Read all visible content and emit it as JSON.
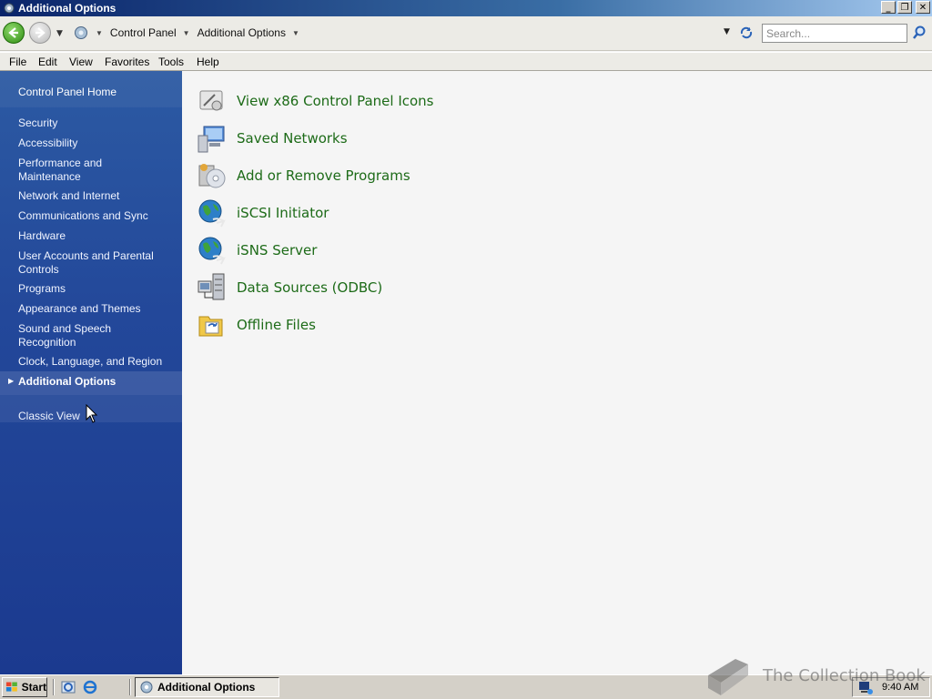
{
  "window": {
    "title": "Additional Options"
  },
  "address": {
    "crumbs": [
      "Control Panel",
      "Additional Options"
    ],
    "search_placeholder": "Search..."
  },
  "menu": [
    "File",
    "Edit",
    "View",
    "Favorites",
    "Tools",
    "Help"
  ],
  "sidebar": {
    "home": "Control Panel Home",
    "categories": [
      "Security",
      "Accessibility",
      "Performance and Maintenance",
      "Network and Internet",
      "Communications and Sync",
      "Hardware",
      "User Accounts and Parental Controls",
      "Programs",
      "Appearance and Themes",
      "Sound and Speech Recognition",
      "Clock, Language, and Region",
      "Additional Options"
    ],
    "active": "Additional Options",
    "classic": "Classic View"
  },
  "tasks": [
    {
      "label": "View x86 Control Panel Icons",
      "icon": "control-panel-x86-icon"
    },
    {
      "label": "Saved Networks",
      "icon": "network-computer-icon"
    },
    {
      "label": "Add or Remove Programs",
      "icon": "add-remove-programs-icon"
    },
    {
      "label": "iSCSI Initiator",
      "icon": "globe-icon"
    },
    {
      "label": "iSNS Server",
      "icon": "globe-icon"
    },
    {
      "label": "Data Sources (ODBC)",
      "icon": "odbc-icon"
    },
    {
      "label": "Offline Files",
      "icon": "offline-files-icon"
    }
  ],
  "taskbar": {
    "start": "Start",
    "active_window": "Additional Options",
    "clock": "9:40 AM"
  },
  "watermark": "The Collection Book",
  "colors": {
    "task_link": "#1d6b18",
    "sidebar": "#23489a",
    "titlebar": "#0a246a"
  }
}
